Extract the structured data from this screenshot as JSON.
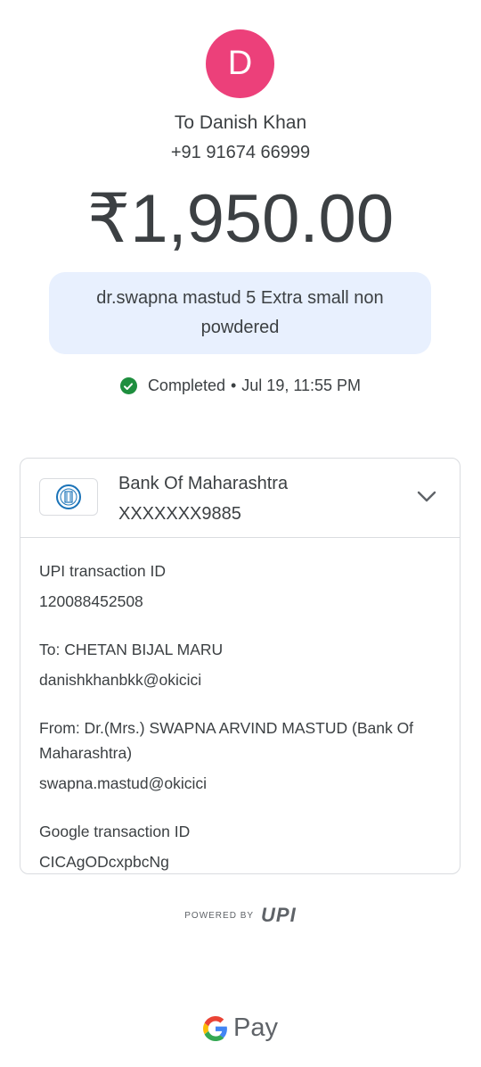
{
  "payee": {
    "avatar_initial": "D",
    "avatar_color": "#ec407a",
    "name_line": "To Danish Khan",
    "phone": "+91 91674 66999"
  },
  "amount": "₹1,950.00",
  "note": "dr.swapna mastud 5 Extra small non powdered",
  "status": {
    "label": "Completed",
    "separator": "•",
    "datetime": "Jul 19, 11:55 PM",
    "color": "#1e8e3e",
    "icon": "check-circle-icon"
  },
  "bank": {
    "name": "Bank Of Maharashtra",
    "account": "XXXXXXX9885",
    "icon": "bank-logo-icon",
    "expand_icon": "chevron-down-icon"
  },
  "details": {
    "upi_label": "UPI transaction ID",
    "upi_value": "120088452508",
    "to_label": "To: CHETAN BIJAL MARU",
    "to_value": "danishkhanbkk@okicici",
    "from_label": "From: Dr.(Mrs.) SWAPNA ARVIND MASTUD (Bank Of Maharashtra)",
    "from_value": "swapna.mastud@okicici",
    "google_label": "Google transaction ID",
    "google_value": "CICAgODcxpbcNg"
  },
  "footer": {
    "powered_by": "POWERED BY",
    "upi_logo": "UPI",
    "gpay_text": "Pay"
  }
}
